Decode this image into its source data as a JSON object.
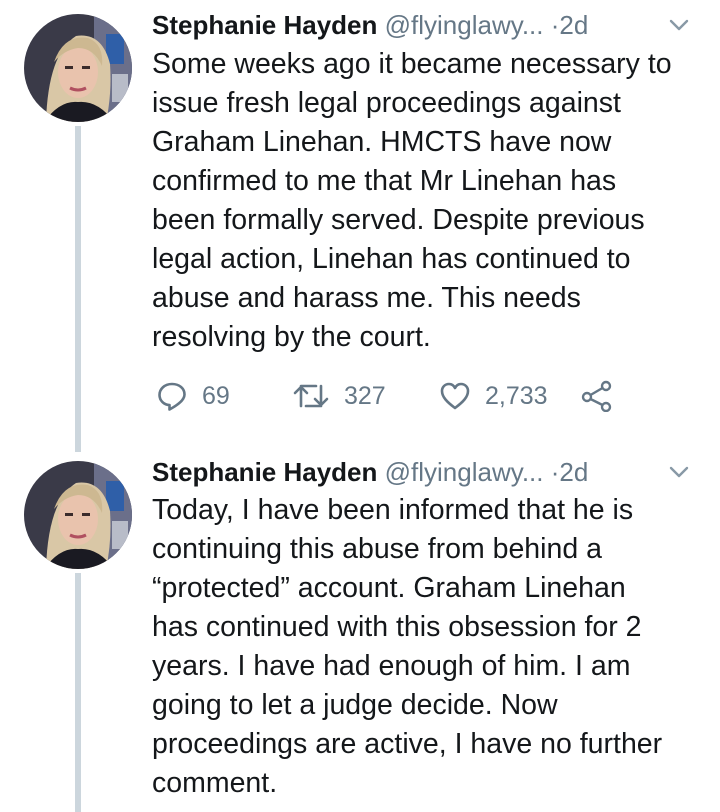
{
  "tweets": [
    {
      "author": "Stephanie Hayden",
      "handle": "@flyinglawy...",
      "dot": "·",
      "time": "2d",
      "text": "Some weeks ago it became necessary to\nissue fresh legal proceedings against\nGraham Linehan. HMCTS have now\nconfirmed to me that Mr Linehan has\nbeen formally served. Despite previous\nlegal action, Linehan has continued to\nabuse and harass me. This needs\nresolving by the court.",
      "replies": "69",
      "retweets": "327",
      "likes": "2,733",
      "icons": [
        "reply-icon",
        "retweet-icon",
        "like-icon",
        "share-icon",
        "chevron-down-icon"
      ]
    },
    {
      "author": "Stephanie Hayden",
      "handle": "@flyinglawy...",
      "dot": "·",
      "time": "2d",
      "text": "Today, I have been informed that he is\ncontinuing this abuse from behind a\n“protected” account. Graham Linehan\nhas continued with this obsession for 2\nyears. I have had enough of him. I am\ngoing to let a judge decide. Now\nproceedings are active, I have no further\ncomment."
    }
  ],
  "colors": {
    "text": "#14171a",
    "secondary": "#657786",
    "thread_line": "#ccd6dd"
  }
}
